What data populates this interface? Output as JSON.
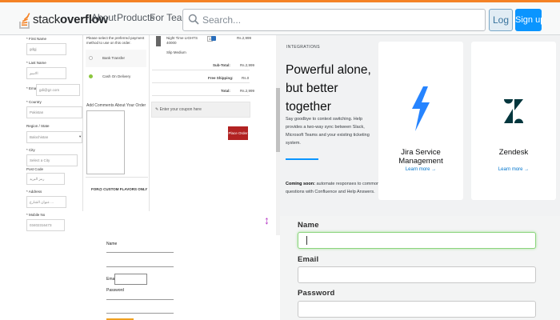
{
  "header": {
    "logo_prefix": "stack",
    "logo_suffix": "overflow",
    "nav": [
      "About",
      "Products",
      "For Teams"
    ],
    "search_placeholder": "Search...",
    "login_label": "Log in",
    "signup_label": "Sign up",
    "accent_color": "#f48225"
  },
  "checkout": {
    "fields": [
      {
        "label": "* First Name",
        "value": "gdgj"
      },
      {
        "label": "* Last Name",
        "value": "الاسم"
      },
      {
        "label": "* Email",
        "value": "gdi@gz.com"
      },
      {
        "label": "* Country",
        "value": "Pakistan"
      },
      {
        "label": "Region / State",
        "value": "Balochistan"
      },
      {
        "label": "* City",
        "value": "Select a City"
      },
      {
        "label": "Post Code",
        "value": "رمز البريد"
      },
      {
        "label": "* Address",
        "value": "عنوان الشارع ..."
      },
      {
        "label": "* Mobile No",
        "value": "03402316473"
      }
    ],
    "payment_prompt": "Please select the preferred payment method to use on this order.",
    "payment_options": [
      "Bank Transfer",
      "Cash On Delivery"
    ],
    "comments_label": "Add Comments About Your Order",
    "custom_note": "FOR@ CUSTOM FLAVORS ONLY",
    "product_name": "Night Time LIGHTS 40000",
    "product_sub": "Slip Medium",
    "product_qty": "1",
    "product_price": "Rs.2,999",
    "summary": [
      {
        "label": "Sub-Total:",
        "value": "Rs.2,999"
      },
      {
        "label": "Free Shipping:",
        "value": "Rs.0"
      },
      {
        "label": "Total:",
        "value": "Rs.2,999"
      }
    ],
    "coupon_placeholder": "Enter your coupon here",
    "place_order_label": "Place Order"
  },
  "integrations": {
    "eyebrow": "INTEGRATIONS",
    "title": "Powerful alone, but better together",
    "body": "Say goodbye to context switching. Help provides a two-way sync between Slack, Microsoft Teams and your existing ticketing system.",
    "coming_label": "Coming soon:",
    "coming_text": "automate responses to common questions with Confluence and Help Answers.",
    "cards": [
      {
        "name": "Jira Service Management",
        "link": "Learn more →",
        "icon": "jira-icon",
        "color": "#2684ff"
      },
      {
        "name": "Zendesk",
        "link": "Learn more →",
        "icon": "zendesk-icon",
        "color": "#03363d"
      }
    ]
  },
  "mini_form": {
    "name_label": "Name",
    "email_label": "Email",
    "password_label": "Password"
  },
  "signup_form": {
    "name_label": "Name",
    "email_label": "Email",
    "password_label": "Password",
    "name_value": "",
    "email_value": "",
    "password_value": ""
  }
}
